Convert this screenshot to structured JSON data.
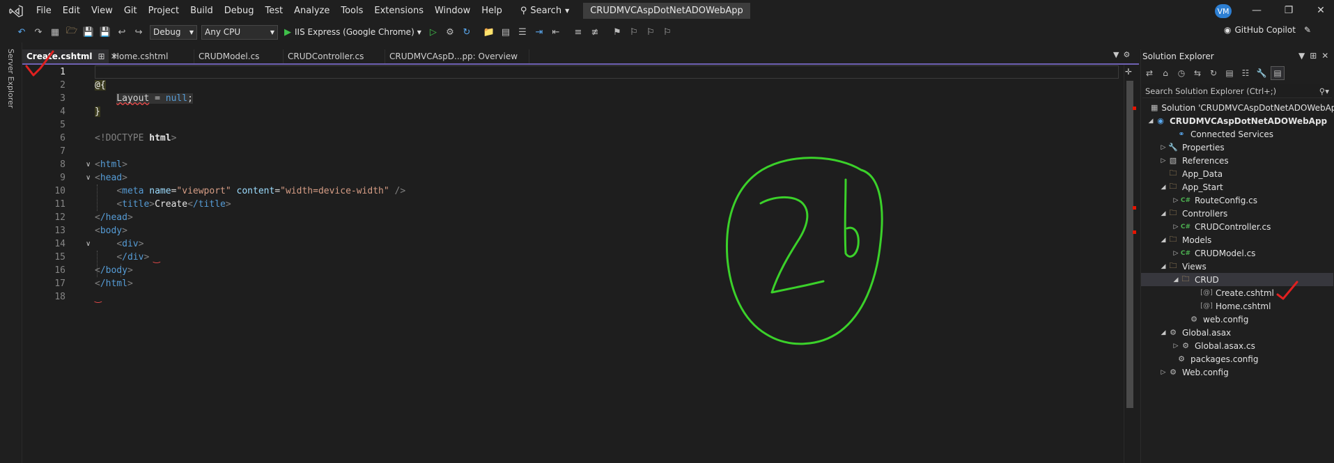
{
  "menu": {
    "items": [
      "File",
      "Edit",
      "View",
      "Git",
      "Project",
      "Build",
      "Debug",
      "Test",
      "Analyze",
      "Tools",
      "Extensions",
      "Window",
      "Help"
    ],
    "search_label": "Search",
    "solution_title": "CRUDMVCAspDotNetADOWebApp",
    "avatar_initials": "VM"
  },
  "toolbar": {
    "configuration": "Debug",
    "platform": "Any CPU",
    "run_target": "IIS Express (Google Chrome)",
    "copilot_label": "GitHub Copilot"
  },
  "side_strip": {
    "server_explorer": "Server Explorer"
  },
  "tabs": [
    {
      "label": "Create.cshtml",
      "active": true
    },
    {
      "label": "Home.cshtml",
      "active": false
    },
    {
      "label": "CRUDModel.cs",
      "active": false
    },
    {
      "label": "CRUDController.cs",
      "active": false
    },
    {
      "label": "CRUDMVCAspD...pp: Overview",
      "active": false
    }
  ],
  "editor": {
    "line_numbers": [
      "1",
      "2",
      "3",
      "4",
      "5",
      "6",
      "7",
      "8",
      "9",
      "10",
      "11",
      "12",
      "13",
      "14",
      "15",
      "16",
      "17",
      "18"
    ],
    "current_line": "1",
    "code": {
      "l2_razor": "@{",
      "l3_layout": "Layout",
      "l3_eq": " = ",
      "l3_null": "null",
      "l3_semi": ";",
      "l4_close": "}",
      "l6_doctype": "<!DOCTYPE ",
      "l6_html": "html",
      "l6_end": ">",
      "l8_open": "<",
      "l8_tag": "html",
      "l8_close": ">",
      "l9_tag": "head",
      "l10_tag": "meta",
      "l10_attr1": "name",
      "l10_val1": "\"viewport\"",
      "l10_attr2": "content",
      "l10_val2": "\"width=device-width\"",
      "l10_end": " />",
      "l11_tag": "title",
      "l11_text": "Create",
      "l11_end_tag": "/title",
      "l12_tag": "/head",
      "l13_tag": "body",
      "l14_tag": "div",
      "l15_tag": "/div",
      "l16_tag": "/body",
      "l17_tag": "/html"
    }
  },
  "solution_explorer": {
    "title": "Solution Explorer",
    "search_placeholder": "Search Solution Explorer (Ctrl+;)",
    "tree": [
      {
        "label": "Solution 'CRUDMVCAspDotNetADOWebApp'",
        "icon": "solution-icon",
        "expander": ""
      },
      {
        "label": "CRUDMVCAspDotNetADOWebApp",
        "icon": "project-icon",
        "expander": "expanded"
      },
      {
        "label": "Connected Services",
        "icon": "connected-services-icon",
        "expander": ""
      },
      {
        "label": "Properties",
        "icon": "wrench-icon",
        "expander": "collapsed"
      },
      {
        "label": "References",
        "icon": "references-icon",
        "expander": "collapsed"
      },
      {
        "label": "App_Data",
        "icon": "folder-icon",
        "expander": ""
      },
      {
        "label": "App_Start",
        "icon": "folder-icon",
        "expander": "expanded"
      },
      {
        "label": "RouteConfig.cs",
        "icon": "csharp-file-icon",
        "expander": "collapsed"
      },
      {
        "label": "Controllers",
        "icon": "folder-icon",
        "expander": "expanded"
      },
      {
        "label": "CRUDController.cs",
        "icon": "csharp-file-icon",
        "expander": "collapsed"
      },
      {
        "label": "Models",
        "icon": "folder-icon",
        "expander": "expanded"
      },
      {
        "label": "CRUDModel.cs",
        "icon": "csharp-file-icon",
        "expander": "collapsed"
      },
      {
        "label": "Views",
        "icon": "folder-icon",
        "expander": "expanded"
      },
      {
        "label": "CRUD",
        "icon": "folder-icon",
        "expander": "expanded",
        "selected": true
      },
      {
        "label": "Create.cshtml",
        "icon": "razor-file-icon",
        "expander": ""
      },
      {
        "label": "Home.cshtml",
        "icon": "razor-file-icon",
        "expander": ""
      },
      {
        "label": "web.config",
        "icon": "config-file-icon",
        "expander": ""
      },
      {
        "label": "Global.asax",
        "icon": "config-file-icon",
        "expander": "expanded"
      },
      {
        "label": "Global.asax.cs",
        "icon": "config-file-icon",
        "expander": "collapsed"
      },
      {
        "label": "packages.config",
        "icon": "config-file-icon",
        "expander": ""
      },
      {
        "label": "Web.config",
        "icon": "config-file-icon",
        "expander": "collapsed"
      }
    ]
  },
  "annotation": {
    "handwritten_number": "2b",
    "ink_color": "#3bd12a",
    "check_color": "#e02020"
  },
  "colors": {
    "accent_tab_line": "#6f61b3",
    "error_marker": "#e51400"
  }
}
